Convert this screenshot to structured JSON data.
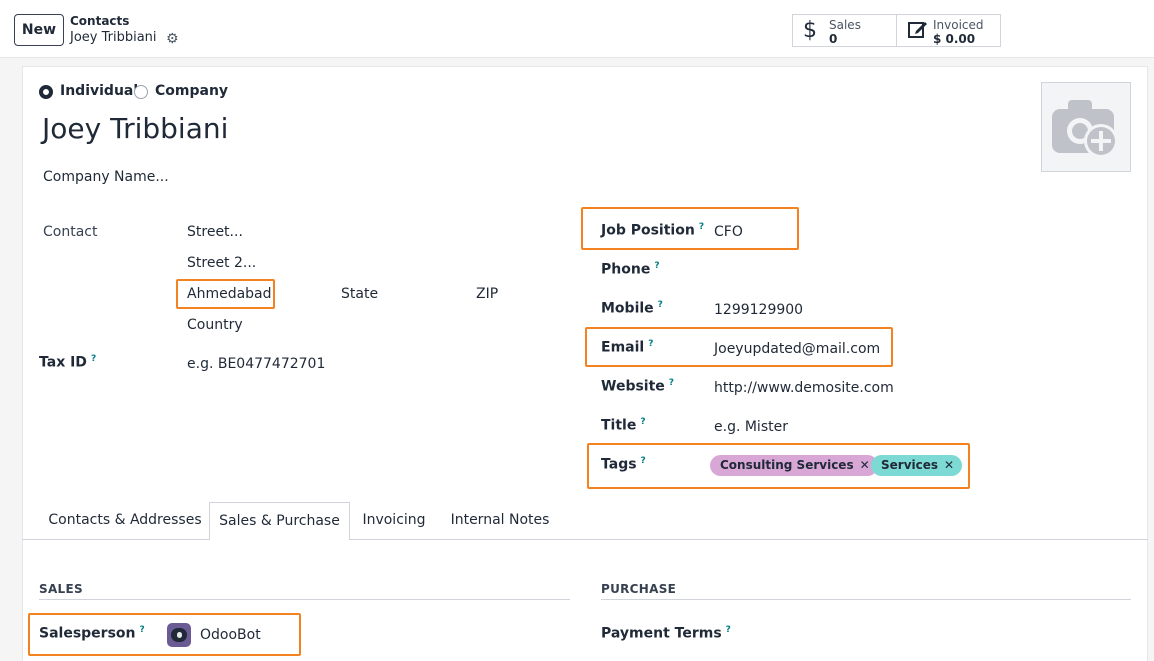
{
  "control": {
    "new_label": "New",
    "breadcrumb_parent": "Contacts",
    "breadcrumb_current": "Joey Tribbiani",
    "stats": [
      {
        "icon": "dollar-icon",
        "label": "Sales",
        "value": "0"
      },
      {
        "icon": "edit-icon",
        "label": "Invoiced",
        "value": "$ 0.00"
      }
    ]
  },
  "form": {
    "type_options": {
      "individual": "Individual",
      "company": "Company",
      "selected": "Individual"
    },
    "name": "Joey Tribbiani",
    "company_placeholder": "Company Name...",
    "contact_label": "Contact",
    "address": {
      "street_placeholder": "Street...",
      "street2_placeholder": "Street 2...",
      "city": "Ahmedabad",
      "state_placeholder": "State",
      "zip_placeholder": "ZIP",
      "country_placeholder": "Country"
    },
    "tax_id_label": "Tax ID",
    "tax_id_placeholder": "e.g. BE0477472701",
    "help_mark": "?",
    "job_position_label": "Job Position",
    "job_position": "CFO",
    "phone_label": "Phone",
    "phone": "",
    "mobile_label": "Mobile",
    "mobile": "1299129900",
    "email_label": "Email",
    "email": "Joeyupdated@mail.com",
    "website_label": "Website",
    "website": "http://www.demosite.com",
    "title_label": "Title",
    "title_placeholder": "e.g. Mister",
    "tags_label": "Tags",
    "tags": [
      {
        "label": "Consulting Services",
        "color": "#d8a7d6"
      },
      {
        "label": "Services",
        "color": "#7dd9d3"
      }
    ],
    "tag_remove_glyph": "✕"
  },
  "tabs": [
    "Contacts & Addresses",
    "Sales & Purchase",
    "Invoicing",
    "Internal Notes"
  ],
  "active_tab": "Sales & Purchase",
  "sales_section": {
    "title": "SALES",
    "salesperson_label": "Salesperson",
    "salesperson": "OdooBot"
  },
  "purchase_section": {
    "title": "PURCHASE",
    "payment_terms_label": "Payment Terms"
  },
  "highlight_color": "#f58220"
}
